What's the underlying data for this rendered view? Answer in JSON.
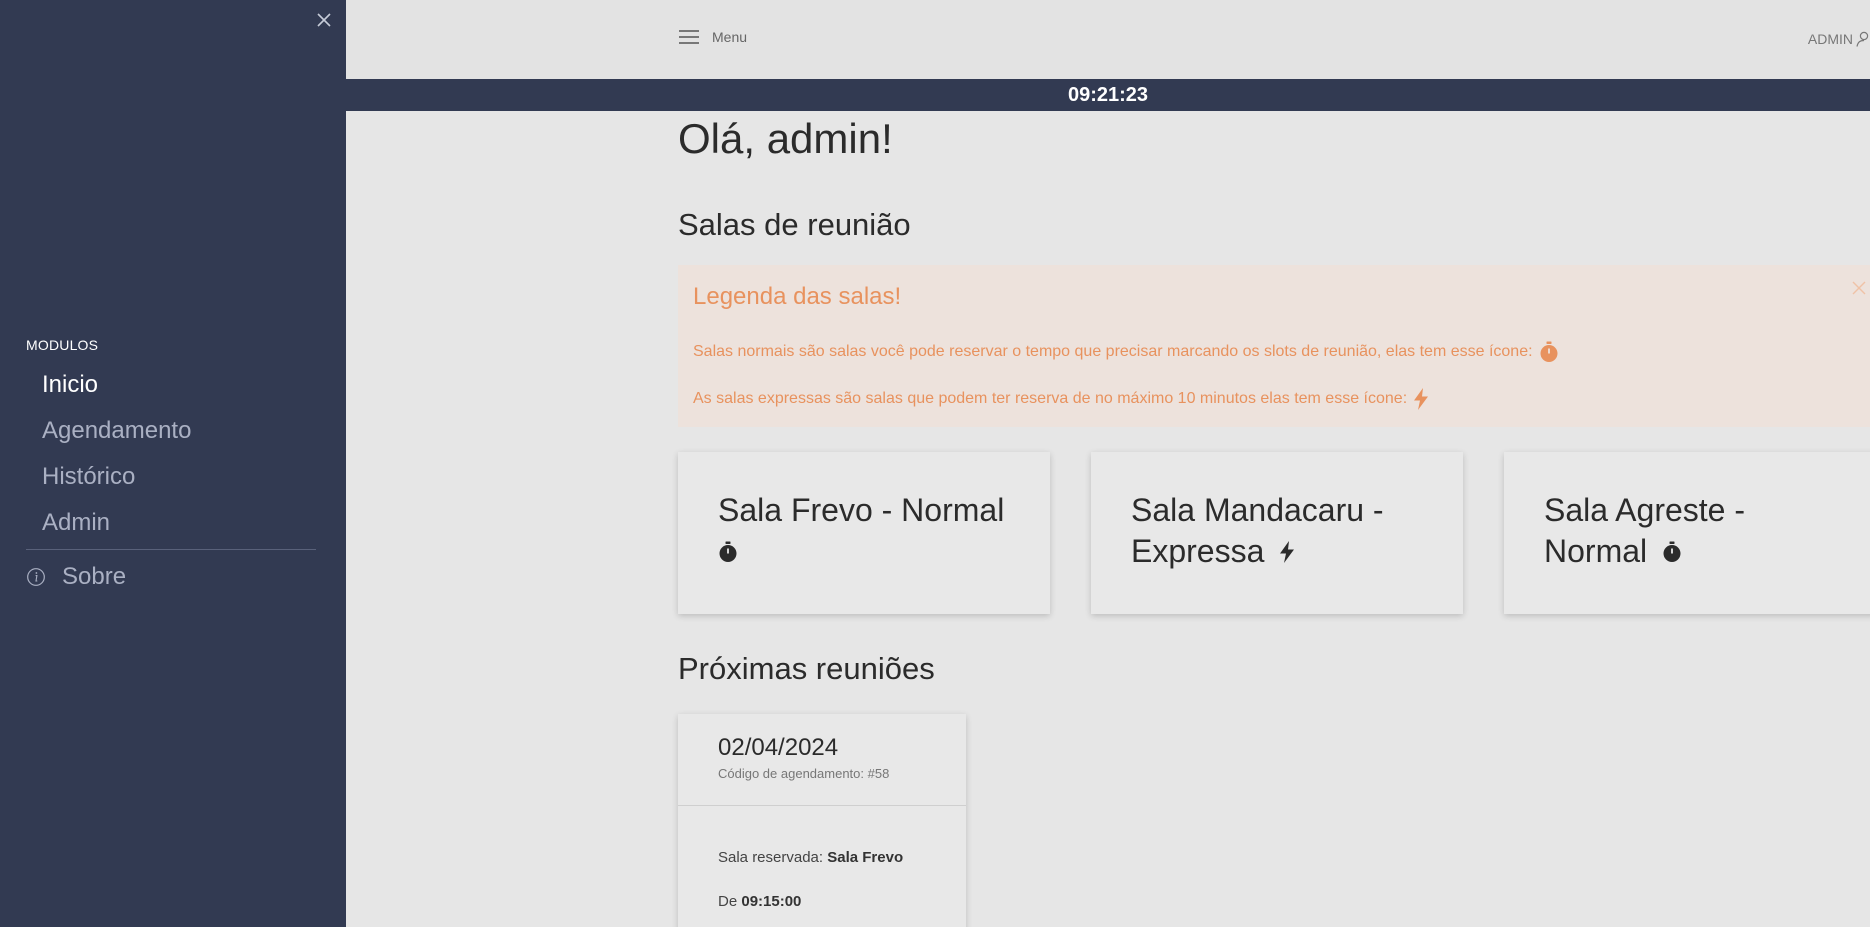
{
  "sidebar": {
    "section_label": "MODULOS",
    "items": [
      {
        "label": "Inicio",
        "active": true
      },
      {
        "label": "Agendamento",
        "active": false
      },
      {
        "label": "Histórico",
        "active": false
      },
      {
        "label": "Admin",
        "active": false
      }
    ],
    "about_label": "Sobre",
    "close_icon": "close-icon",
    "about_icon": "info-icon"
  },
  "topbar": {
    "menu_label": "Menu",
    "user_label": "ADMIN",
    "menu_icon": "hamburger-icon",
    "user_icon": "user-icon"
  },
  "clock": "09:21:23",
  "main": {
    "greeting": "Olá, admin!",
    "rooms_heading": "Salas de reunião",
    "legend": {
      "title": "Legenda das salas!",
      "normal_text": "Salas normais são salas você pode reservar o tempo que precisar marcando os slots de reunião, elas tem esse ícone:",
      "express_text": "As salas expressas são salas que podem ter reserva de no máximo 10 minutos elas tem esse ícone:",
      "normal_icon": "stopwatch-icon",
      "express_icon": "bolt-icon"
    },
    "rooms": [
      {
        "title": "Sala Frevo - Normal",
        "icon": "stopwatch-icon"
      },
      {
        "title": "Sala Mandacaru - Expressa",
        "icon": "bolt-icon"
      },
      {
        "title": "Sala Agreste - Normal",
        "icon": "stopwatch-icon"
      }
    ],
    "upcoming_heading": "Próximas reuniões",
    "meetings": [
      {
        "date": "02/04/2024",
        "code_label": "Código de agendamento: #58",
        "room_prefix": "Sala reservada:",
        "room_name": "Sala Frevo",
        "from_prefix": "De",
        "from_time": "09:15:00"
      }
    ]
  },
  "colors": {
    "sidebar_bg": "#323a52",
    "accent_orange": "#e8925e",
    "alert_bg": "#ede2dc",
    "page_bg": "#e6e6e6"
  }
}
